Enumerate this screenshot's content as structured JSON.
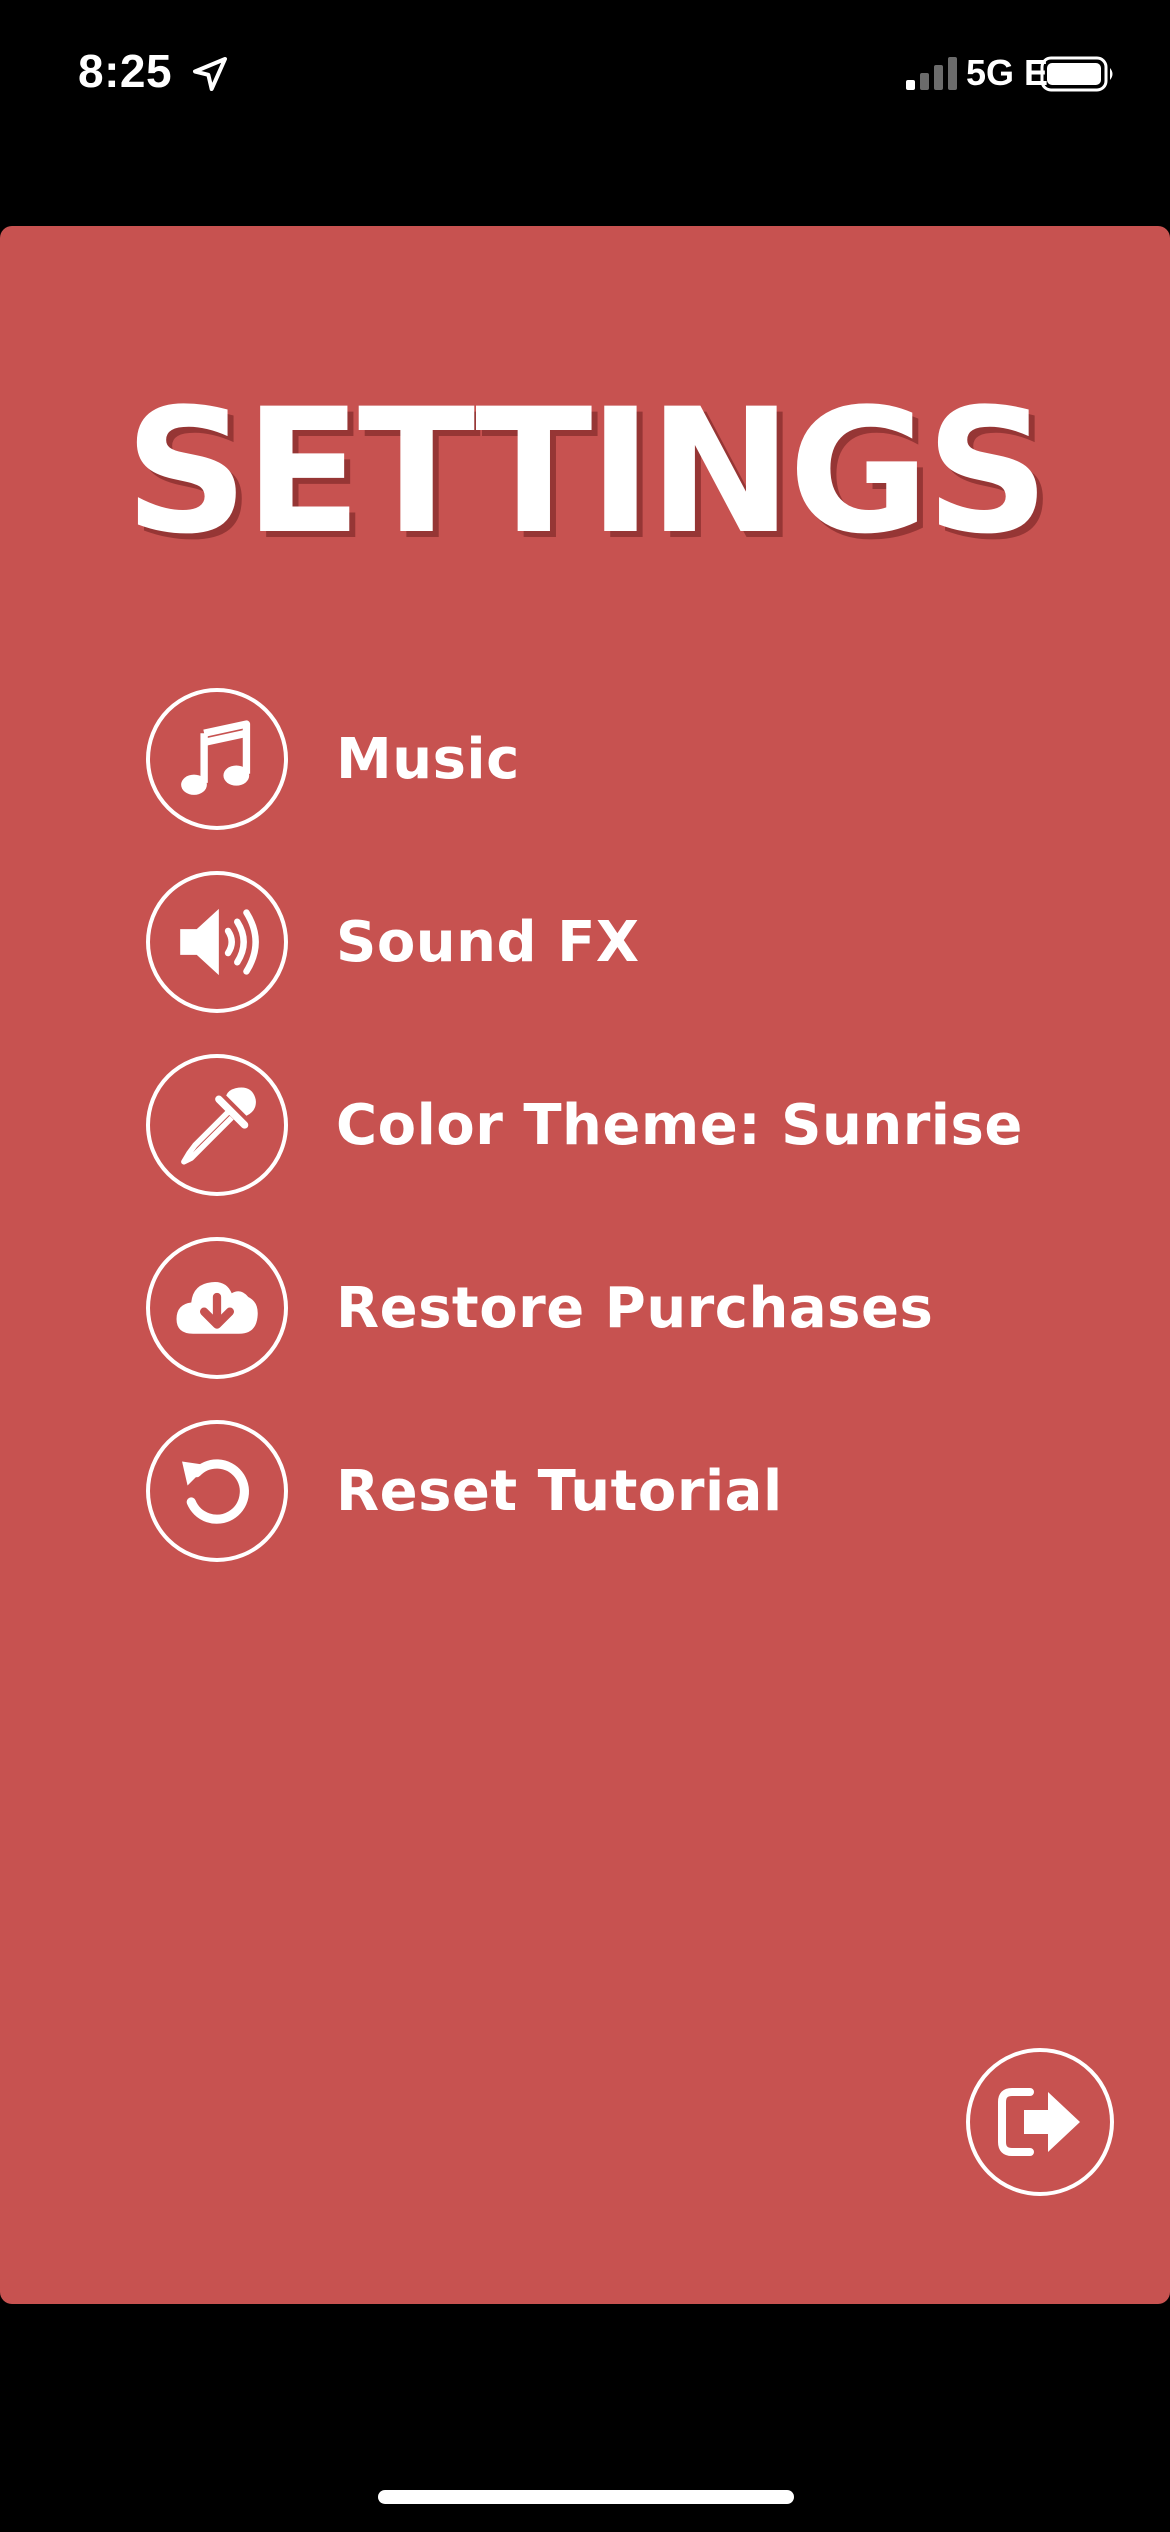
{
  "status_bar": {
    "time": "8:25",
    "network": "5G E",
    "icons": [
      "location-arrow-icon",
      "signal-bars-icon",
      "battery-icon"
    ]
  },
  "settings": {
    "title": "SETTINGS",
    "background_color": "#c75250",
    "items": [
      {
        "label": "Music",
        "icon": "music-note-icon"
      },
      {
        "label": "Sound FX",
        "icon": "speaker-icon"
      },
      {
        "label": "Color Theme: Sunrise",
        "icon": "eyedropper-icon"
      },
      {
        "label": "Restore Purchases",
        "icon": "cloud-download-icon"
      },
      {
        "label": "Reset Tutorial",
        "icon": "undo-icon"
      }
    ],
    "exit_icon": "exit-arrow-icon"
  }
}
